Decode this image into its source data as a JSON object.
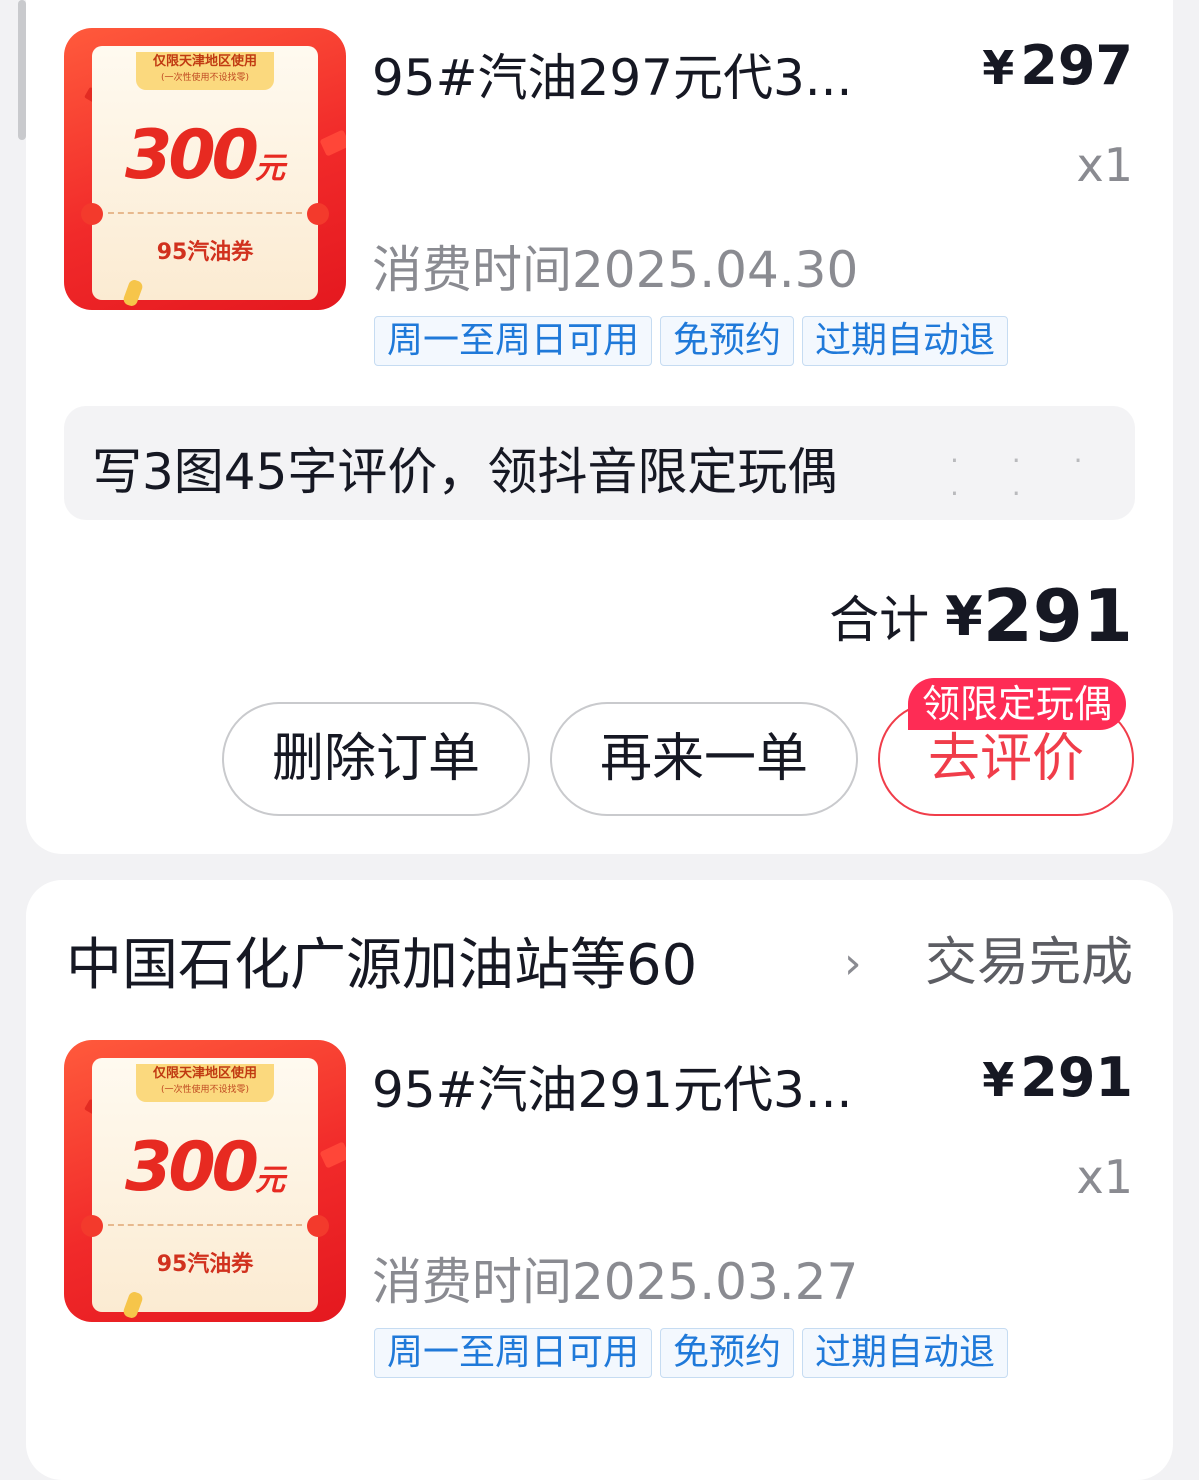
{
  "orders": [
    {
      "thumbnail": {
        "ribbon_line1": "仅限天津地区使用",
        "ribbon_line2": "(一次性使用不设找零)",
        "amount": "300",
        "amount_unit": "元",
        "type": "95汽油券"
      },
      "item_title": "95#汽油297元代3...",
      "currency": "¥",
      "price": "297",
      "quantity": "x1",
      "consume_time": "消费时间2025.04.30",
      "tags": [
        "周一至周日可用",
        "免预约",
        "过期自动退"
      ],
      "review_promo": "写3图45字评价，领抖音限定玩偶",
      "total_label": "合计",
      "total_value": "291",
      "buttons": {
        "delete": "删除订单",
        "reorder": "再来一单",
        "review": "去评价",
        "review_badge": "领限定玩偶"
      }
    },
    {
      "shop_name": "中国石化广源加油站等60",
      "status": "交易完成",
      "thumbnail": {
        "ribbon_line1": "仅限天津地区使用",
        "ribbon_line2": "(一次性使用不设找零)",
        "amount": "300",
        "amount_unit": "元",
        "type": "95汽油券"
      },
      "item_title": "95#汽油291元代3...",
      "currency": "¥",
      "price": "291",
      "quantity": "x1",
      "consume_time": "消费时间2025.03.27",
      "tags": [
        "周一至周日可用",
        "免预约",
        "过期自动退"
      ]
    }
  ],
  "colors": {
    "accent_red": "#f03d4a",
    "badge_red": "#fe2c55",
    "tag_blue": "#1f79d9",
    "muted_text": "#8a8b91"
  }
}
